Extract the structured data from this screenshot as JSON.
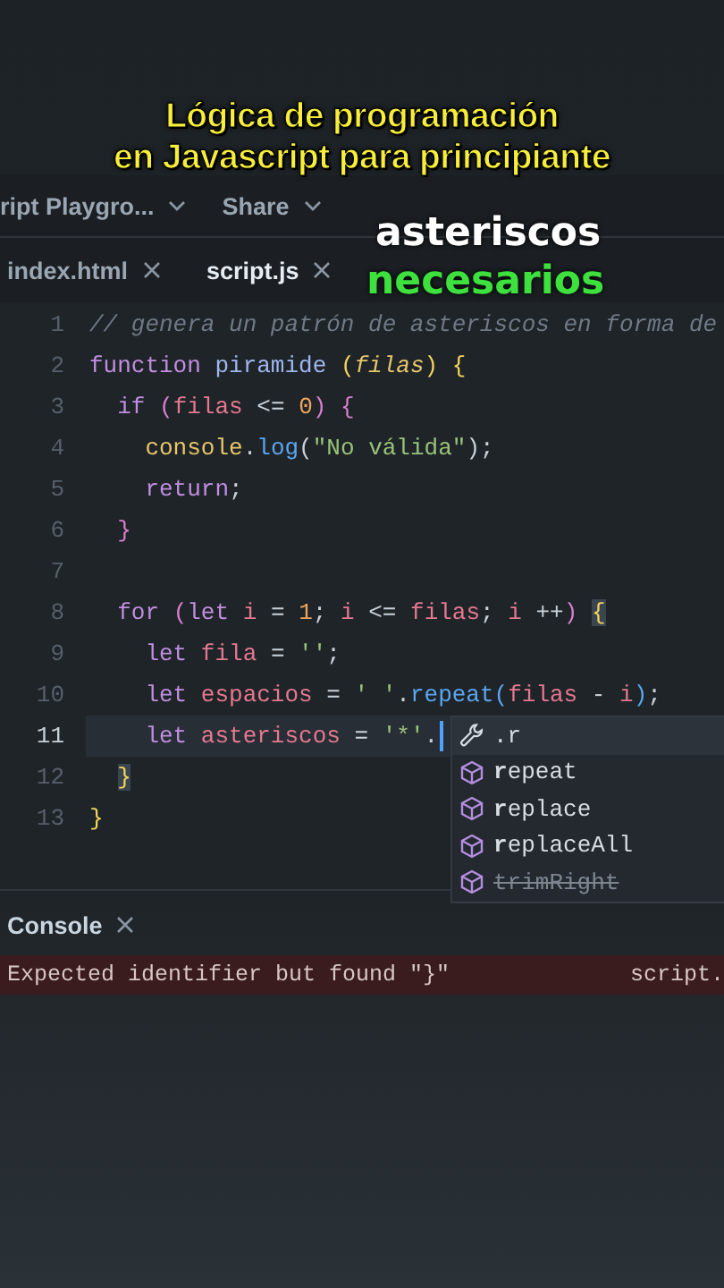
{
  "caption": {
    "title_lines": [
      "Lógica de programación",
      "en Javascript para principiante"
    ],
    "overlay_words": [
      {
        "text": "asteriscos",
        "color": "#ffffff"
      },
      {
        "text": "necesarios",
        "color": "#3ee03e"
      }
    ]
  },
  "header": {
    "project": "ript Playgro...",
    "share": "Share"
  },
  "tabs": [
    {
      "label": "index.html",
      "selected": false
    },
    {
      "label": "script.js",
      "selected": true
    }
  ],
  "editor": {
    "lines": [
      {
        "number": "1",
        "current": false,
        "tokens": [
          {
            "kind": "comment",
            "text": "// genera un patrón de asteriscos en forma de"
          }
        ]
      },
      {
        "number": "2",
        "current": false,
        "tokens": [
          {
            "kind": "keyword",
            "text": "function "
          },
          {
            "kind": "function",
            "text": "piramide "
          },
          {
            "kind": "bracket",
            "text": "("
          },
          {
            "kind": "param",
            "text": "filas"
          },
          {
            "kind": "bracket",
            "text": ") "
          },
          {
            "kind": "bracket",
            "text": "{"
          }
        ]
      },
      {
        "number": "3",
        "current": false,
        "tokens": [
          {
            "kind": "keyword",
            "text": "  if "
          },
          {
            "kind": "bracket2",
            "text": "("
          },
          {
            "kind": "variable",
            "text": "filas"
          },
          {
            "kind": "operator",
            "text": " <= "
          },
          {
            "kind": "number",
            "text": "0"
          },
          {
            "kind": "bracket2",
            "text": ") "
          },
          {
            "kind": "bracket2",
            "text": "{"
          }
        ]
      },
      {
        "number": "4",
        "current": false,
        "tokens": [
          {
            "kind": "object",
            "text": "    console"
          },
          {
            "kind": "punct",
            "text": "."
          },
          {
            "kind": "method",
            "text": "log"
          },
          {
            "kind": "punct",
            "text": "("
          },
          {
            "kind": "string",
            "text": "\"No válida\""
          },
          {
            "kind": "punct",
            "text": ");"
          }
        ]
      },
      {
        "number": "5",
        "current": false,
        "tokens": [
          {
            "kind": "keyword",
            "text": "    return"
          },
          {
            "kind": "punct",
            "text": ";"
          }
        ]
      },
      {
        "number": "6",
        "current": false,
        "tokens": [
          {
            "kind": "bracket2",
            "text": "  }"
          }
        ]
      },
      {
        "number": "7",
        "current": false
      },
      {
        "number": "8",
        "current": false,
        "tokens": [
          {
            "kind": "keyword",
            "text": "  for "
          },
          {
            "kind": "bracket2",
            "text": "("
          },
          {
            "kind": "keyword",
            "text": "let "
          },
          {
            "kind": "variable",
            "text": "i"
          },
          {
            "kind": "operator",
            "text": " = "
          },
          {
            "kind": "number",
            "text": "1"
          },
          {
            "kind": "punct",
            "text": "; "
          },
          {
            "kind": "variable",
            "text": "i"
          },
          {
            "kind": "operator",
            "text": " <= "
          },
          {
            "kind": "variable",
            "text": "filas"
          },
          {
            "kind": "punct",
            "text": "; "
          },
          {
            "kind": "variable",
            "text": "i"
          },
          {
            "kind": "operator",
            "text": " ++"
          },
          {
            "kind": "bracket2",
            "text": ") "
          },
          {
            "kind": "match",
            "text": "{"
          }
        ]
      },
      {
        "number": "9",
        "current": false,
        "tokens": [
          {
            "kind": "keyword",
            "text": "    let "
          },
          {
            "kind": "variable",
            "text": "fila"
          },
          {
            "kind": "operator",
            "text": " = "
          },
          {
            "kind": "string",
            "text": "''"
          },
          {
            "kind": "punct",
            "text": ";"
          }
        ]
      },
      {
        "number": "10",
        "current": false,
        "tokens": [
          {
            "kind": "keyword",
            "text": "    let "
          },
          {
            "kind": "variable",
            "text": "espacios"
          },
          {
            "kind": "operator",
            "text": " = "
          },
          {
            "kind": "string",
            "text": "' '"
          },
          {
            "kind": "punct",
            "text": "."
          },
          {
            "kind": "method",
            "text": "repeat"
          },
          {
            "kind": "bracket3",
            "text": "("
          },
          {
            "kind": "variable",
            "text": "filas"
          },
          {
            "kind": "operator",
            "text": " - "
          },
          {
            "kind": "variable",
            "text": "i"
          },
          {
            "kind": "bracket3",
            "text": ")"
          },
          {
            "kind": "punct",
            "text": ";"
          }
        ]
      },
      {
        "number": "11",
        "current": true,
        "tokens": [
          {
            "kind": "keyword",
            "text": "    let "
          },
          {
            "kind": "variable",
            "text": "asteriscos"
          },
          {
            "kind": "operator",
            "text": " = "
          },
          {
            "kind": "string",
            "text": "'*'"
          },
          {
            "kind": "punct",
            "text": "."
          }
        ]
      },
      {
        "number": "12",
        "current": false,
        "tokens": [
          {
            "kind": "match",
            "text": "}",
            "indented": true
          }
        ]
      },
      {
        "number": "13",
        "current": false,
        "tokens": [
          {
            "kind": "bracket",
            "text": "}"
          }
        ]
      }
    ]
  },
  "autocomplete": {
    "items": [
      {
        "kind": "snippet",
        "label": ".r",
        "selected": true,
        "deprecated": false
      },
      {
        "kind": "method",
        "label": "**r**epeat",
        "selected": false,
        "deprecated": false
      },
      {
        "kind": "method",
        "label": "**r**eplace",
        "selected": false,
        "deprecated": false
      },
      {
        "kind": "method",
        "label": "**r**eplaceAll",
        "selected": false,
        "deprecated": false
      },
      {
        "kind": "method",
        "label": "trimRight",
        "selected": false,
        "deprecated": true
      }
    ]
  },
  "console": {
    "title": "Console",
    "errors": [
      {
        "message": "Expected identifier but found \"}\"",
        "source": "script."
      }
    ]
  }
}
